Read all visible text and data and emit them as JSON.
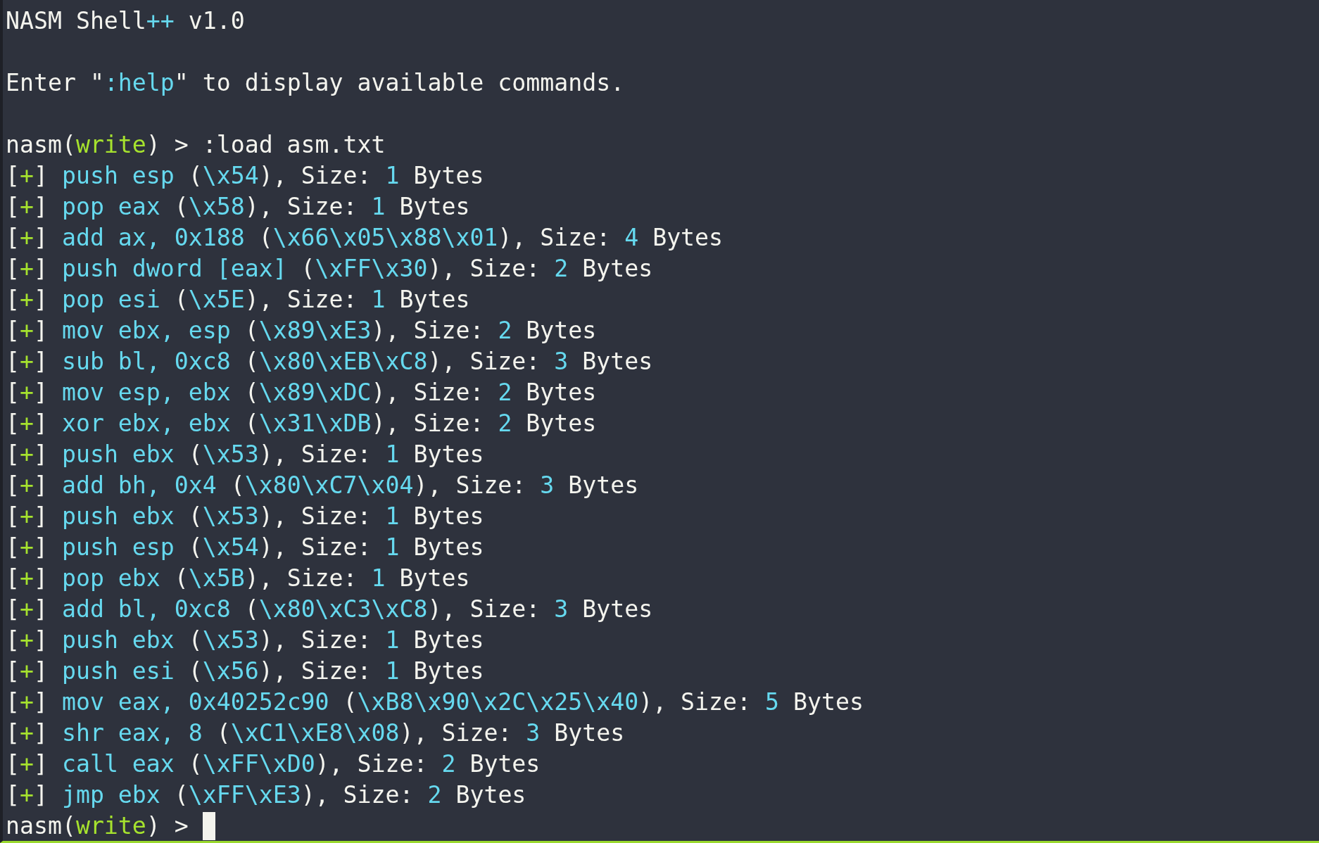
{
  "terminal": {
    "lines": [
      {
        "kind": "banner",
        "cursor": false,
        "segments": [
          {
            "text": "NASM Shell",
            "color": "#f4f4ee"
          },
          {
            "text": "++",
            "color": "#66d9ef"
          },
          {
            "text": " v1.0",
            "color": "#f4f4ee"
          }
        ]
      },
      {
        "kind": "banner",
        "cursor": false,
        "segments": [
          {
            "text": "Enter \"",
            "color": "#f4f4ee"
          },
          {
            "text": ":help",
            "color": "#66d9ef"
          },
          {
            "text": "\" to display available commands.",
            "color": "#f4f4ee"
          }
        ]
      },
      {
        "kind": "prompt",
        "cursor": false,
        "segments": [
          {
            "text": "nasm(",
            "color": "#f4f4ee"
          },
          {
            "text": "write",
            "color": "#a6e22e"
          },
          {
            "text": ") > :load asm.txt",
            "color": "#f4f4ee"
          }
        ]
      },
      {
        "kind": "result",
        "cursor": false,
        "segments": [
          {
            "text": "[",
            "color": "#f4f4ee"
          },
          {
            "text": "+",
            "color": "#a6e22e"
          },
          {
            "text": "] ",
            "color": "#f4f4ee"
          },
          {
            "text": "push esp",
            "color": "#66d9ef"
          },
          {
            "text": " (",
            "color": "#f4f4ee"
          },
          {
            "text": "\\x54",
            "color": "#66d9ef"
          },
          {
            "text": "), Size: ",
            "color": "#f4f4ee"
          },
          {
            "text": "1",
            "color": "#66d9ef"
          },
          {
            "text": " Bytes",
            "color": "#f4f4ee"
          }
        ]
      },
      {
        "kind": "result",
        "cursor": false,
        "segments": [
          {
            "text": "[",
            "color": "#f4f4ee"
          },
          {
            "text": "+",
            "color": "#a6e22e"
          },
          {
            "text": "] ",
            "color": "#f4f4ee"
          },
          {
            "text": "pop eax",
            "color": "#66d9ef"
          },
          {
            "text": " (",
            "color": "#f4f4ee"
          },
          {
            "text": "\\x58",
            "color": "#66d9ef"
          },
          {
            "text": "), Size: ",
            "color": "#f4f4ee"
          },
          {
            "text": "1",
            "color": "#66d9ef"
          },
          {
            "text": " Bytes",
            "color": "#f4f4ee"
          }
        ]
      },
      {
        "kind": "result",
        "cursor": false,
        "segments": [
          {
            "text": "[",
            "color": "#f4f4ee"
          },
          {
            "text": "+",
            "color": "#a6e22e"
          },
          {
            "text": "] ",
            "color": "#f4f4ee"
          },
          {
            "text": "add ax, 0x188",
            "color": "#66d9ef"
          },
          {
            "text": " (",
            "color": "#f4f4ee"
          },
          {
            "text": "\\x66\\x05\\x88\\x01",
            "color": "#66d9ef"
          },
          {
            "text": "), Size: ",
            "color": "#f4f4ee"
          },
          {
            "text": "4",
            "color": "#66d9ef"
          },
          {
            "text": " Bytes",
            "color": "#f4f4ee"
          }
        ]
      },
      {
        "kind": "result",
        "cursor": false,
        "segments": [
          {
            "text": "[",
            "color": "#f4f4ee"
          },
          {
            "text": "+",
            "color": "#a6e22e"
          },
          {
            "text": "] ",
            "color": "#f4f4ee"
          },
          {
            "text": "push dword [eax]",
            "color": "#66d9ef"
          },
          {
            "text": " (",
            "color": "#f4f4ee"
          },
          {
            "text": "\\xFF\\x30",
            "color": "#66d9ef"
          },
          {
            "text": "), Size: ",
            "color": "#f4f4ee"
          },
          {
            "text": "2",
            "color": "#66d9ef"
          },
          {
            "text": " Bytes",
            "color": "#f4f4ee"
          }
        ]
      },
      {
        "kind": "result",
        "cursor": false,
        "segments": [
          {
            "text": "[",
            "color": "#f4f4ee"
          },
          {
            "text": "+",
            "color": "#a6e22e"
          },
          {
            "text": "] ",
            "color": "#f4f4ee"
          },
          {
            "text": "pop esi",
            "color": "#66d9ef"
          },
          {
            "text": " (",
            "color": "#f4f4ee"
          },
          {
            "text": "\\x5E",
            "color": "#66d9ef"
          },
          {
            "text": "), Size: ",
            "color": "#f4f4ee"
          },
          {
            "text": "1",
            "color": "#66d9ef"
          },
          {
            "text": " Bytes",
            "color": "#f4f4ee"
          }
        ]
      },
      {
        "kind": "result",
        "cursor": false,
        "segments": [
          {
            "text": "[",
            "color": "#f4f4ee"
          },
          {
            "text": "+",
            "color": "#a6e22e"
          },
          {
            "text": "] ",
            "color": "#f4f4ee"
          },
          {
            "text": "mov ebx, esp",
            "color": "#66d9ef"
          },
          {
            "text": " (",
            "color": "#f4f4ee"
          },
          {
            "text": "\\x89\\xE3",
            "color": "#66d9ef"
          },
          {
            "text": "), Size: ",
            "color": "#f4f4ee"
          },
          {
            "text": "2",
            "color": "#66d9ef"
          },
          {
            "text": " Bytes",
            "color": "#f4f4ee"
          }
        ]
      },
      {
        "kind": "result",
        "cursor": false,
        "segments": [
          {
            "text": "[",
            "color": "#f4f4ee"
          },
          {
            "text": "+",
            "color": "#a6e22e"
          },
          {
            "text": "] ",
            "color": "#f4f4ee"
          },
          {
            "text": "sub bl, 0xc8",
            "color": "#66d9ef"
          },
          {
            "text": " (",
            "color": "#f4f4ee"
          },
          {
            "text": "\\x80\\xEB\\xC8",
            "color": "#66d9ef"
          },
          {
            "text": "), Size: ",
            "color": "#f4f4ee"
          },
          {
            "text": "3",
            "color": "#66d9ef"
          },
          {
            "text": " Bytes",
            "color": "#f4f4ee"
          }
        ]
      },
      {
        "kind": "result",
        "cursor": false,
        "segments": [
          {
            "text": "[",
            "color": "#f4f4ee"
          },
          {
            "text": "+",
            "color": "#a6e22e"
          },
          {
            "text": "] ",
            "color": "#f4f4ee"
          },
          {
            "text": "mov esp, ebx",
            "color": "#66d9ef"
          },
          {
            "text": " (",
            "color": "#f4f4ee"
          },
          {
            "text": "\\x89\\xDC",
            "color": "#66d9ef"
          },
          {
            "text": "), Size: ",
            "color": "#f4f4ee"
          },
          {
            "text": "2",
            "color": "#66d9ef"
          },
          {
            "text": " Bytes",
            "color": "#f4f4ee"
          }
        ]
      },
      {
        "kind": "result",
        "cursor": false,
        "segments": [
          {
            "text": "[",
            "color": "#f4f4ee"
          },
          {
            "text": "+",
            "color": "#a6e22e"
          },
          {
            "text": "] ",
            "color": "#f4f4ee"
          },
          {
            "text": "xor ebx, ebx",
            "color": "#66d9ef"
          },
          {
            "text": " (",
            "color": "#f4f4ee"
          },
          {
            "text": "\\x31\\xDB",
            "color": "#66d9ef"
          },
          {
            "text": "), Size: ",
            "color": "#f4f4ee"
          },
          {
            "text": "2",
            "color": "#66d9ef"
          },
          {
            "text": " Bytes",
            "color": "#f4f4ee"
          }
        ]
      },
      {
        "kind": "result",
        "cursor": false,
        "segments": [
          {
            "text": "[",
            "color": "#f4f4ee"
          },
          {
            "text": "+",
            "color": "#a6e22e"
          },
          {
            "text": "] ",
            "color": "#f4f4ee"
          },
          {
            "text": "push ebx",
            "color": "#66d9ef"
          },
          {
            "text": " (",
            "color": "#f4f4ee"
          },
          {
            "text": "\\x53",
            "color": "#66d9ef"
          },
          {
            "text": "), Size: ",
            "color": "#f4f4ee"
          },
          {
            "text": "1",
            "color": "#66d9ef"
          },
          {
            "text": " Bytes",
            "color": "#f4f4ee"
          }
        ]
      },
      {
        "kind": "result",
        "cursor": false,
        "segments": [
          {
            "text": "[",
            "color": "#f4f4ee"
          },
          {
            "text": "+",
            "color": "#a6e22e"
          },
          {
            "text": "] ",
            "color": "#f4f4ee"
          },
          {
            "text": "add bh, 0x4",
            "color": "#66d9ef"
          },
          {
            "text": " (",
            "color": "#f4f4ee"
          },
          {
            "text": "\\x80\\xC7\\x04",
            "color": "#66d9ef"
          },
          {
            "text": "), Size: ",
            "color": "#f4f4ee"
          },
          {
            "text": "3",
            "color": "#66d9ef"
          },
          {
            "text": " Bytes",
            "color": "#f4f4ee"
          }
        ]
      },
      {
        "kind": "result",
        "cursor": false,
        "segments": [
          {
            "text": "[",
            "color": "#f4f4ee"
          },
          {
            "text": "+",
            "color": "#a6e22e"
          },
          {
            "text": "] ",
            "color": "#f4f4ee"
          },
          {
            "text": "push ebx",
            "color": "#66d9ef"
          },
          {
            "text": " (",
            "color": "#f4f4ee"
          },
          {
            "text": "\\x53",
            "color": "#66d9ef"
          },
          {
            "text": "), Size: ",
            "color": "#f4f4ee"
          },
          {
            "text": "1",
            "color": "#66d9ef"
          },
          {
            "text": " Bytes",
            "color": "#f4f4ee"
          }
        ]
      },
      {
        "kind": "result",
        "cursor": false,
        "segments": [
          {
            "text": "[",
            "color": "#f4f4ee"
          },
          {
            "text": "+",
            "color": "#a6e22e"
          },
          {
            "text": "] ",
            "color": "#f4f4ee"
          },
          {
            "text": "push esp",
            "color": "#66d9ef"
          },
          {
            "text": " (",
            "color": "#f4f4ee"
          },
          {
            "text": "\\x54",
            "color": "#66d9ef"
          },
          {
            "text": "), Size: ",
            "color": "#f4f4ee"
          },
          {
            "text": "1",
            "color": "#66d9ef"
          },
          {
            "text": " Bytes",
            "color": "#f4f4ee"
          }
        ]
      },
      {
        "kind": "result",
        "cursor": false,
        "segments": [
          {
            "text": "[",
            "color": "#f4f4ee"
          },
          {
            "text": "+",
            "color": "#a6e22e"
          },
          {
            "text": "] ",
            "color": "#f4f4ee"
          },
          {
            "text": "pop ebx",
            "color": "#66d9ef"
          },
          {
            "text": " (",
            "color": "#f4f4ee"
          },
          {
            "text": "\\x5B",
            "color": "#66d9ef"
          },
          {
            "text": "), Size: ",
            "color": "#f4f4ee"
          },
          {
            "text": "1",
            "color": "#66d9ef"
          },
          {
            "text": " Bytes",
            "color": "#f4f4ee"
          }
        ]
      },
      {
        "kind": "result",
        "cursor": false,
        "segments": [
          {
            "text": "[",
            "color": "#f4f4ee"
          },
          {
            "text": "+",
            "color": "#a6e22e"
          },
          {
            "text": "] ",
            "color": "#f4f4ee"
          },
          {
            "text": "add bl, 0xc8",
            "color": "#66d9ef"
          },
          {
            "text": " (",
            "color": "#f4f4ee"
          },
          {
            "text": "\\x80\\xC3\\xC8",
            "color": "#66d9ef"
          },
          {
            "text": "), Size: ",
            "color": "#f4f4ee"
          },
          {
            "text": "3",
            "color": "#66d9ef"
          },
          {
            "text": " Bytes",
            "color": "#f4f4ee"
          }
        ]
      },
      {
        "kind": "result",
        "cursor": false,
        "segments": [
          {
            "text": "[",
            "color": "#f4f4ee"
          },
          {
            "text": "+",
            "color": "#a6e22e"
          },
          {
            "text": "] ",
            "color": "#f4f4ee"
          },
          {
            "text": "push ebx",
            "color": "#66d9ef"
          },
          {
            "text": " (",
            "color": "#f4f4ee"
          },
          {
            "text": "\\x53",
            "color": "#66d9ef"
          },
          {
            "text": "), Size: ",
            "color": "#f4f4ee"
          },
          {
            "text": "1",
            "color": "#66d9ef"
          },
          {
            "text": " Bytes",
            "color": "#f4f4ee"
          }
        ]
      },
      {
        "kind": "result",
        "cursor": false,
        "segments": [
          {
            "text": "[",
            "color": "#f4f4ee"
          },
          {
            "text": "+",
            "color": "#a6e22e"
          },
          {
            "text": "] ",
            "color": "#f4f4ee"
          },
          {
            "text": "push esi",
            "color": "#66d9ef"
          },
          {
            "text": " (",
            "color": "#f4f4ee"
          },
          {
            "text": "\\x56",
            "color": "#66d9ef"
          },
          {
            "text": "), Size: ",
            "color": "#f4f4ee"
          },
          {
            "text": "1",
            "color": "#66d9ef"
          },
          {
            "text": " Bytes",
            "color": "#f4f4ee"
          }
        ]
      },
      {
        "kind": "result",
        "cursor": false,
        "segments": [
          {
            "text": "[",
            "color": "#f4f4ee"
          },
          {
            "text": "+",
            "color": "#a6e22e"
          },
          {
            "text": "] ",
            "color": "#f4f4ee"
          },
          {
            "text": "mov eax, 0x40252c90",
            "color": "#66d9ef"
          },
          {
            "text": " (",
            "color": "#f4f4ee"
          },
          {
            "text": "\\xB8\\x90\\x2C\\x25\\x40",
            "color": "#66d9ef"
          },
          {
            "text": "), Size: ",
            "color": "#f4f4ee"
          },
          {
            "text": "5",
            "color": "#66d9ef"
          },
          {
            "text": " Bytes",
            "color": "#f4f4ee"
          }
        ]
      },
      {
        "kind": "result",
        "cursor": false,
        "segments": [
          {
            "text": "[",
            "color": "#f4f4ee"
          },
          {
            "text": "+",
            "color": "#a6e22e"
          },
          {
            "text": "] ",
            "color": "#f4f4ee"
          },
          {
            "text": "shr eax, 8",
            "color": "#66d9ef"
          },
          {
            "text": " (",
            "color": "#f4f4ee"
          },
          {
            "text": "\\xC1\\xE8\\x08",
            "color": "#66d9ef"
          },
          {
            "text": "), Size: ",
            "color": "#f4f4ee"
          },
          {
            "text": "3",
            "color": "#66d9ef"
          },
          {
            "text": " Bytes",
            "color": "#f4f4ee"
          }
        ]
      },
      {
        "kind": "result",
        "cursor": false,
        "segments": [
          {
            "text": "[",
            "color": "#f4f4ee"
          },
          {
            "text": "+",
            "color": "#a6e22e"
          },
          {
            "text": "] ",
            "color": "#f4f4ee"
          },
          {
            "text": "call eax",
            "color": "#66d9ef"
          },
          {
            "text": " (",
            "color": "#f4f4ee"
          },
          {
            "text": "\\xFF\\xD0",
            "color": "#66d9ef"
          },
          {
            "text": "), Size: ",
            "color": "#f4f4ee"
          },
          {
            "text": "2",
            "color": "#66d9ef"
          },
          {
            "text": " Bytes",
            "color": "#f4f4ee"
          }
        ]
      },
      {
        "kind": "result",
        "cursor": false,
        "segments": [
          {
            "text": "[",
            "color": "#f4f4ee"
          },
          {
            "text": "+",
            "color": "#a6e22e"
          },
          {
            "text": "] ",
            "color": "#f4f4ee"
          },
          {
            "text": "jmp ebx",
            "color": "#66d9ef"
          },
          {
            "text": " (",
            "color": "#f4f4ee"
          },
          {
            "text": "\\xFF\\xE3",
            "color": "#66d9ef"
          },
          {
            "text": "), Size: ",
            "color": "#f4f4ee"
          },
          {
            "text": "2",
            "color": "#66d9ef"
          },
          {
            "text": " Bytes",
            "color": "#f4f4ee"
          }
        ]
      },
      {
        "kind": "prompt",
        "cursor": true,
        "segments": [
          {
            "text": "nasm(",
            "color": "#f4f4ee"
          },
          {
            "text": "write",
            "color": "#a6e22e"
          },
          {
            "text": ") >",
            "color": "#f4f4ee"
          }
        ]
      }
    ]
  }
}
